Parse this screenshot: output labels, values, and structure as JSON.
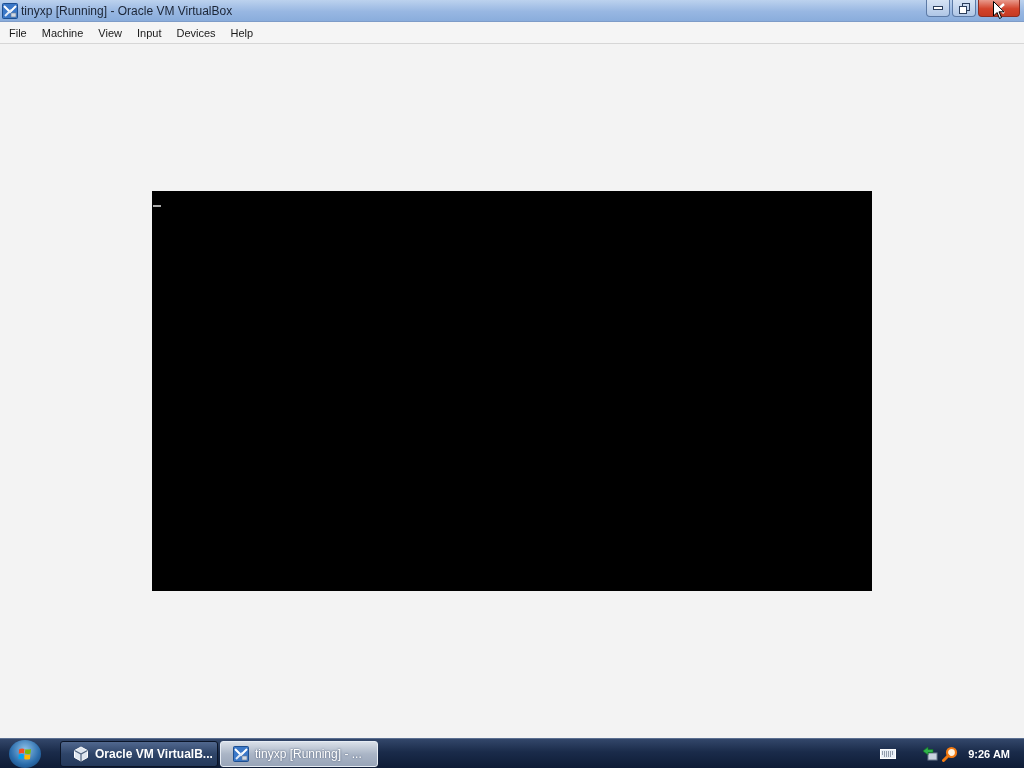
{
  "window": {
    "title": "tinyxp [Running] - Oracle VM VirtualBox"
  },
  "menu": [
    "File",
    "Machine",
    "View",
    "Input",
    "Devices",
    "Help"
  ],
  "taskbar": {
    "items": [
      {
        "label": "Oracle VM VirtualB...",
        "kind": "manager",
        "selected": false
      },
      {
        "label": "tinyxp [Running] - ...",
        "kind": "vm",
        "selected": true
      }
    ],
    "clock": "9:26 AM"
  }
}
